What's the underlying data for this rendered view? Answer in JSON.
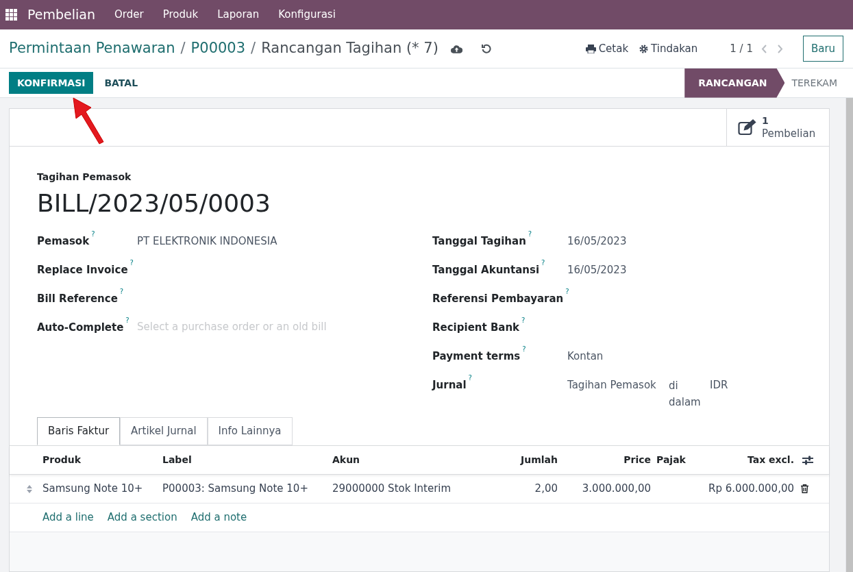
{
  "navbar": {
    "app": "Pembelian",
    "menus": [
      "Order",
      "Produk",
      "Laporan",
      "Konfigurasi"
    ]
  },
  "breadcrumb": [
    {
      "text": "Permintaan Penawaran",
      "kind": "link"
    },
    {
      "text": "/",
      "kind": "separator"
    },
    {
      "text": "P00003",
      "kind": "link"
    },
    {
      "text": "/",
      "kind": "separator"
    },
    {
      "text": "Rancangan Tagihan (* 7)",
      "kind": "current"
    }
  ],
  "actions": {
    "print": "Cetak",
    "action": "Tindakan",
    "pager": "1 / 1",
    "new_button": "Baru"
  },
  "buttons": [
    {
      "label": "KONFIRMASI",
      "kind": "primary"
    },
    {
      "label": "BATAL",
      "kind": "secondary"
    }
  ],
  "statusbar": [
    {
      "label": "RANCANGAN",
      "selected": true
    },
    {
      "label": "TEREKAM",
      "selected": false
    }
  ],
  "smart_button": {
    "count": "1",
    "label": "Pembelian"
  },
  "form": {
    "type_label": "Tagihan Pemasok",
    "name": "BILL/2023/05/0003",
    "left_fields": [
      {
        "label": "Pemasok",
        "help": "?",
        "value": "PT ELEKTRONIK INDONESIA"
      },
      {
        "label": "Replace Invoice",
        "help": "?"
      },
      {
        "label": "Bill Reference",
        "help": "?"
      },
      {
        "label": "Auto-Complete",
        "help": "?",
        "placeholder": "Select a purchase order or an old bill"
      }
    ],
    "right_fields": [
      {
        "label": "Tanggal Tagihan",
        "help": "?",
        "value": "16/05/2023"
      },
      {
        "label": "Tanggal Akuntansi",
        "help": "?",
        "value": "16/05/2023"
      },
      {
        "label": "Referensi Pembayaran",
        "help": "?"
      },
      {
        "label": "Recipient Bank",
        "help": "?"
      },
      {
        "label": "Payment terms",
        "help": "?",
        "value": "Kontan"
      },
      {
        "label": "Jurnal",
        "help": "?",
        "parts": [
          "Tagihan Pemasok",
          "di dalam",
          "IDR"
        ]
      }
    ]
  },
  "tabs": [
    {
      "label": "Baris Faktur",
      "selected": true
    },
    {
      "label": "Artikel Jurnal",
      "selected": false
    },
    {
      "label": "Info Lainnya",
      "selected": false
    }
  ],
  "table": {
    "columns": [
      "Produk",
      "Label",
      "Akun",
      "Jumlah",
      "Price",
      "Pajak",
      "Tax excl."
    ],
    "rows": [
      {
        "cells": [
          "Samsung Note 10+",
          "P00003: Samsung Note 10+",
          "29000000 Stok Interim",
          "2,00",
          "3.000.000,00",
          "",
          "Rp 6.000.000,00"
        ]
      }
    ],
    "add_links": [
      "Add a line",
      "Add a section",
      "Add a note"
    ]
  }
}
